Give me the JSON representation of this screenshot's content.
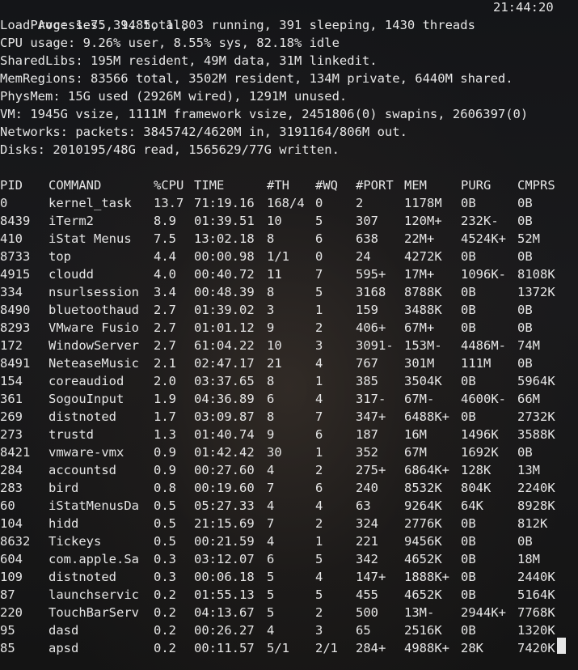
{
  "summary": {
    "processes": "Processes: 394 total, 3 running, 391 sleeping, 1430 threads",
    "clock": "21:44:20",
    "load": "Load Avg: 1.75, 1.85, 1.80",
    "cpu": "CPU usage: 9.26% user, 8.55% sys, 82.18% idle",
    "sharedlibs": "SharedLibs: 195M resident, 49M data, 31M linkedit.",
    "memregions": "MemRegions: 83566 total, 3502M resident, 134M private, 6440M shared.",
    "physmem": "PhysMem: 15G used (2926M wired), 1291M unused.",
    "vm": "VM: 1945G vsize, 1111M framework vsize, 2451806(0) swapins, 2606397(0)",
    "networks": "Networks: packets: 3845742/4620M in, 3191164/806M out.",
    "disks": "Disks: 2010195/48G read, 1565629/77G written."
  },
  "table": {
    "headers": [
      "PID",
      "COMMAND",
      "%CPU",
      "TIME",
      "#TH",
      "#WQ",
      "#PORT",
      "MEM",
      "PURG",
      "CMPRS"
    ],
    "rows": [
      [
        "0",
        "kernel_task",
        "13.7",
        "71:19.16",
        "168/4",
        "0",
        "2",
        "1178M",
        "0B",
        "0B"
      ],
      [
        "8439",
        "iTerm2",
        "8.9",
        "01:39.51",
        "10",
        "5",
        "307",
        "120M+",
        "232K-",
        "0B"
      ],
      [
        "410",
        "iStat Menus",
        "7.5",
        "13:02.18",
        "8",
        "6",
        "638",
        "22M+",
        "4524K+",
        "52M"
      ],
      [
        "8733",
        "top",
        "4.4",
        "00:00.98",
        "1/1",
        "0",
        "24",
        "4272K",
        "0B",
        "0B"
      ],
      [
        "4915",
        "cloudd",
        "4.0",
        "00:40.72",
        "11",
        "7",
        "595+",
        "17M+",
        "1096K-",
        "8108K"
      ],
      [
        "334",
        "nsurlsession",
        "3.4",
        "00:48.39",
        "8",
        "5",
        "3168",
        "8788K",
        "0B",
        "1372K"
      ],
      [
        "8490",
        "bluetoothaud",
        "2.7",
        "01:39.02",
        "3",
        "1",
        "159",
        "3488K",
        "0B",
        "0B"
      ],
      [
        "8293",
        "VMware Fusio",
        "2.7",
        "01:01.12",
        "9",
        "2",
        "406+",
        "67M+",
        "0B",
        "0B"
      ],
      [
        "172",
        "WindowServer",
        "2.7",
        "61:04.22",
        "10",
        "3",
        "3091-",
        "153M-",
        "4486M-",
        "74M"
      ],
      [
        "8491",
        "NeteaseMusic",
        "2.1",
        "02:47.17",
        "21",
        "4",
        "767",
        "301M",
        "111M",
        "0B"
      ],
      [
        "154",
        "coreaudiod",
        "2.0",
        "03:37.65",
        "8",
        "1",
        "385",
        "3504K",
        "0B",
        "5964K"
      ],
      [
        "361",
        "SogouInput",
        "1.9",
        "04:36.89",
        "6",
        "4",
        "317-",
        "67M-",
        "4600K-",
        "66M"
      ],
      [
        "269",
        "distnoted",
        "1.7",
        "03:09.87",
        "8",
        "7",
        "347+",
        "6488K+",
        "0B",
        "2732K"
      ],
      [
        "273",
        "trustd",
        "1.3",
        "01:40.74",
        "9",
        "6",
        "187",
        "16M",
        "1496K",
        "3588K"
      ],
      [
        "8421",
        "vmware-vmx",
        "0.9",
        "01:42.42",
        "30",
        "1",
        "352",
        "67M",
        "1692K",
        "0B"
      ],
      [
        "284",
        "accountsd",
        "0.9",
        "00:27.60",
        "4",
        "2",
        "275+",
        "6864K+",
        "128K",
        "13M"
      ],
      [
        "283",
        "bird",
        "0.8",
        "00:19.60",
        "7",
        "6",
        "240",
        "8532K",
        "804K",
        "2240K"
      ],
      [
        "60",
        "iStatMenusDa",
        "0.5",
        "05:27.33",
        "4",
        "4",
        "63",
        "9264K",
        "64K",
        "8928K"
      ],
      [
        "104",
        "hidd",
        "0.5",
        "21:15.69",
        "7",
        "2",
        "324",
        "2776K",
        "0B",
        "812K"
      ],
      [
        "8632",
        "Tickeys",
        "0.5",
        "00:21.59",
        "4",
        "1",
        "221",
        "9456K",
        "0B",
        "0B"
      ],
      [
        "604",
        "com.apple.Sa",
        "0.3",
        "03:12.07",
        "6",
        "5",
        "342",
        "4652K",
        "0B",
        "18M"
      ],
      [
        "109",
        "distnoted",
        "0.3",
        "00:06.18",
        "5",
        "4",
        "147+",
        "1888K+",
        "0B",
        "2440K"
      ],
      [
        "87",
        "launchservic",
        "0.2",
        "01:55.13",
        "5",
        "5",
        "455",
        "4652K",
        "0B",
        "5164K"
      ],
      [
        "220",
        "TouchBarServ",
        "0.2",
        "04:13.67",
        "5",
        "2",
        "500",
        "13M-",
        "2944K+",
        "7768K"
      ],
      [
        "95",
        "dasd",
        "0.2",
        "00:26.27",
        "4",
        "3",
        "65",
        "2516K",
        "0B",
        "1320K"
      ],
      [
        "85",
        "apsd",
        "0.2",
        "00:11.57",
        "5/1",
        "2/1",
        "284+",
        "4988K+",
        "28K",
        "7420K"
      ]
    ]
  },
  "colors": {
    "text": "#e6e6e6",
    "background": "#0e0e10"
  }
}
